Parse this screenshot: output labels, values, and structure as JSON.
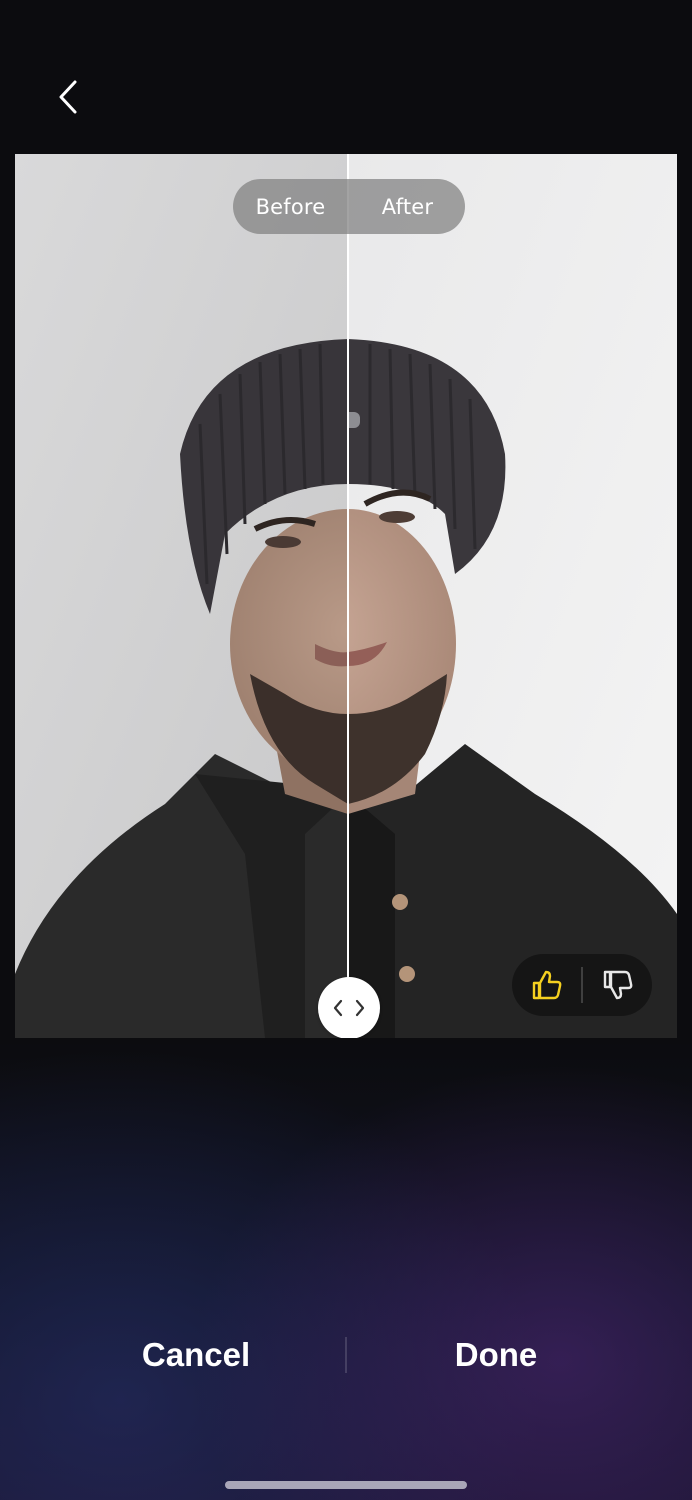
{
  "nav": {
    "back_icon": "chevron-left-icon"
  },
  "compare": {
    "before_label": "Before",
    "after_label": "After",
    "handle_icon": "left-right-arrows-icon"
  },
  "feedback": {
    "like_icon": "thumbs-up-icon",
    "dislike_icon": "thumbs-down-icon",
    "like_color": "#f5d020"
  },
  "actions": {
    "cancel_label": "Cancel",
    "done_label": "Done"
  },
  "colors": {
    "background": "#0c0c0f",
    "accent": "#f5d020"
  }
}
